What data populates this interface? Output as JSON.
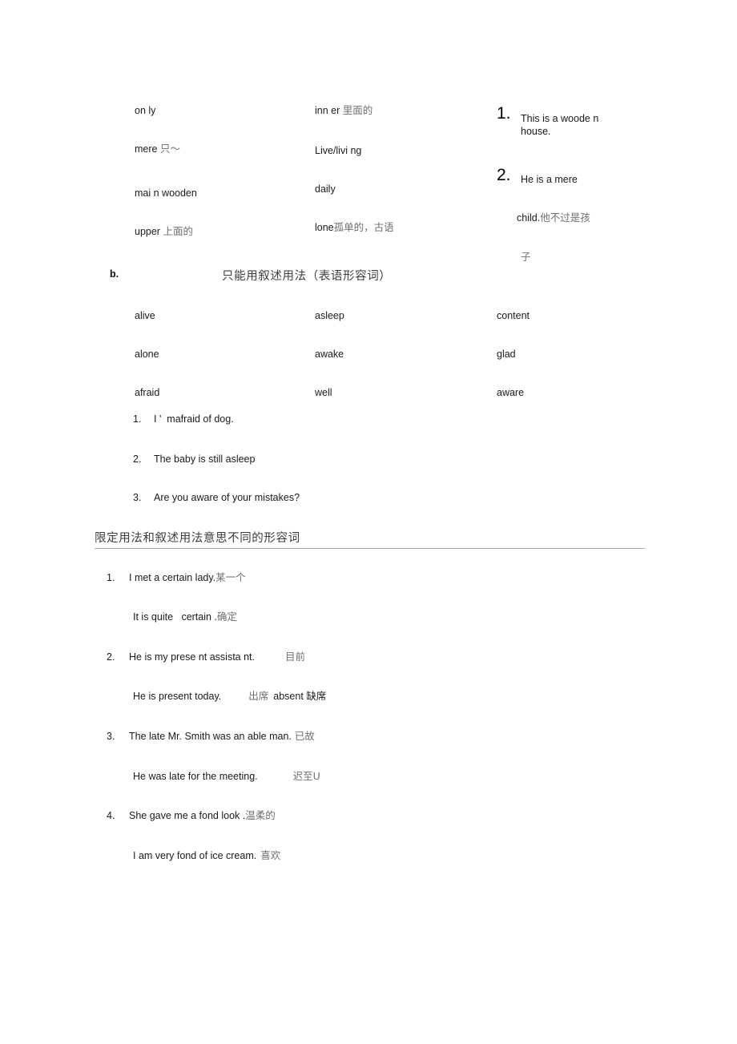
{
  "document": {
    "title": "形容词用法笔记",
    "background_color": "#ffffff",
    "text_color": "#1a1a1a",
    "cjk_gloss_color": "#6f6f6f",
    "rule_color": "#a8a8a8"
  },
  "attributive_block": {
    "column_left": [
      {
        "word": "on ly",
        "gloss": ""
      },
      {
        "word": "mere ",
        "gloss": "只～"
      },
      {
        "word": "mai n wooden",
        "gloss": ""
      },
      {
        "word": "upper ",
        "gloss": "上面的"
      }
    ],
    "column_middle": [
      {
        "word": "inn er ",
        "gloss": "里面的"
      },
      {
        "word": "Live/livi ng",
        "gloss": ""
      },
      {
        "word": "daily",
        "gloss": ""
      },
      {
        "word": "lone",
        "gloss": "孤单的，古语"
      }
    ],
    "column_right_examples": [
      {
        "marker": "1.",
        "line1": "This is a woode n",
        "line2": "house.",
        "gloss": "",
        "gloss2": ""
      },
      {
        "marker": "2.",
        "line1": "He is a mere",
        "line2": "child.",
        "gloss": "他不过是孩",
        "gloss2": "子"
      }
    ]
  },
  "predicative_section": {
    "item_label": "b.",
    "heading": "只能用叙述用法（表语形容词）",
    "words": {
      "column_1": [
        "alive",
        "alone",
        "afraid"
      ],
      "column_2": [
        "asleep",
        "awake",
        "well"
      ],
      "column_3": [
        "content",
        "glad",
        "aware"
      ]
    },
    "examples": [
      {
        "marker": "1.",
        "text": "I '  mafraid of dog."
      },
      {
        "marker": "2.",
        "text": "The baby is still asleep"
      },
      {
        "marker": "3.",
        "text": "Are you aware of your mistakes?"
      }
    ]
  },
  "meaning_difference_section": {
    "heading": "限定用法和叙述用法意思不同的形容词",
    "entries": [
      {
        "marker": "1.",
        "main_text": "I met a certain lady.",
        "main_gloss": "某一个",
        "sub_text": "It is quite   certain .",
        "sub_gloss": "确定",
        "sub_gloss2": ""
      },
      {
        "marker": "2.",
        "main_text": "He is my prese nt assista nt.",
        "main_gloss": "目前",
        "sub_text": "He is present today.",
        "sub_gloss": "出席",
        "sub_gloss2": "absent 缺席"
      },
      {
        "marker": "3.",
        "main_text": "The late Mr. Smith was an able man.",
        "main_gloss": "已故",
        "sub_text": "He was late for the meeting.",
        "sub_gloss": "迟至U",
        "sub_gloss2": ""
      },
      {
        "marker": "4.",
        "main_text": "She gave me a fond look .",
        "main_gloss": "温柔的",
        "sub_text": "I am very fond of ice cream.",
        "sub_gloss": "喜欢",
        "sub_gloss2": ""
      }
    ]
  }
}
